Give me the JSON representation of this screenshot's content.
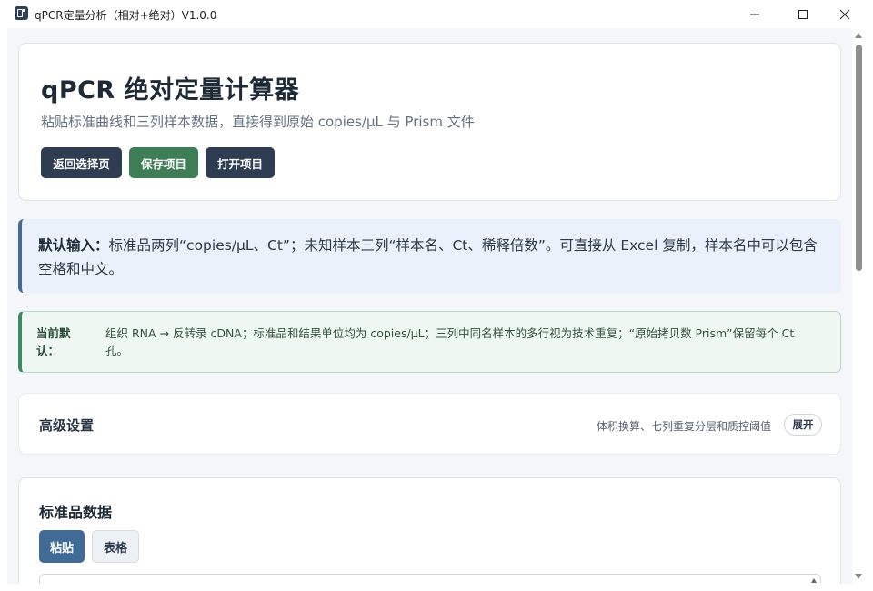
{
  "window": {
    "title": "qPCR定量分析（相对+绝对）V1.0.0",
    "icons": {
      "minimize": "minimize-icon",
      "maximize": "maximize-icon",
      "close": "close-icon",
      "app": "app-icon"
    }
  },
  "header": {
    "title": "qPCR 绝对定量计算器",
    "subtitle": "粘贴标准曲线和三列样本数据，直接得到原始 copies/μL 与 Prism 文件",
    "buttons": {
      "back": "返回选择页",
      "save": "保存项目",
      "open": "打开项目"
    }
  },
  "default_input_notice": {
    "label": "默认输入：",
    "text": "标准品两列“copies/μL、Ct”；未知样本三列“样本名、Ct、稀释倍数”。可直接从 Excel 复制，样本名中可以包含空格和中文。"
  },
  "current_default_notice": {
    "label": "当前默认：",
    "text": "组织 RNA → 反转录 cDNA；标准品和结果单位均为 copies/μL；三列中同名样本的多行视为技术重复；“原始拷贝数 Prism”保留每个 Ct 孔。"
  },
  "advanced": {
    "title": "高级设置",
    "hint": "体积换算、七列重复分层和质控阈值",
    "toggle_label": "展开"
  },
  "standards": {
    "title": "标准品数据",
    "tabs": [
      "粘贴",
      "表格"
    ],
    "active_tab": "粘贴"
  },
  "colors": {
    "primary_dark": "#2f3d52",
    "save_green": "#3f7d57",
    "accent_blue": "#3f6b96",
    "notice_blue_bg": "#eaf1fa",
    "notice_green_bg": "#eef7f1",
    "page_bg": "#f4f6f9"
  }
}
